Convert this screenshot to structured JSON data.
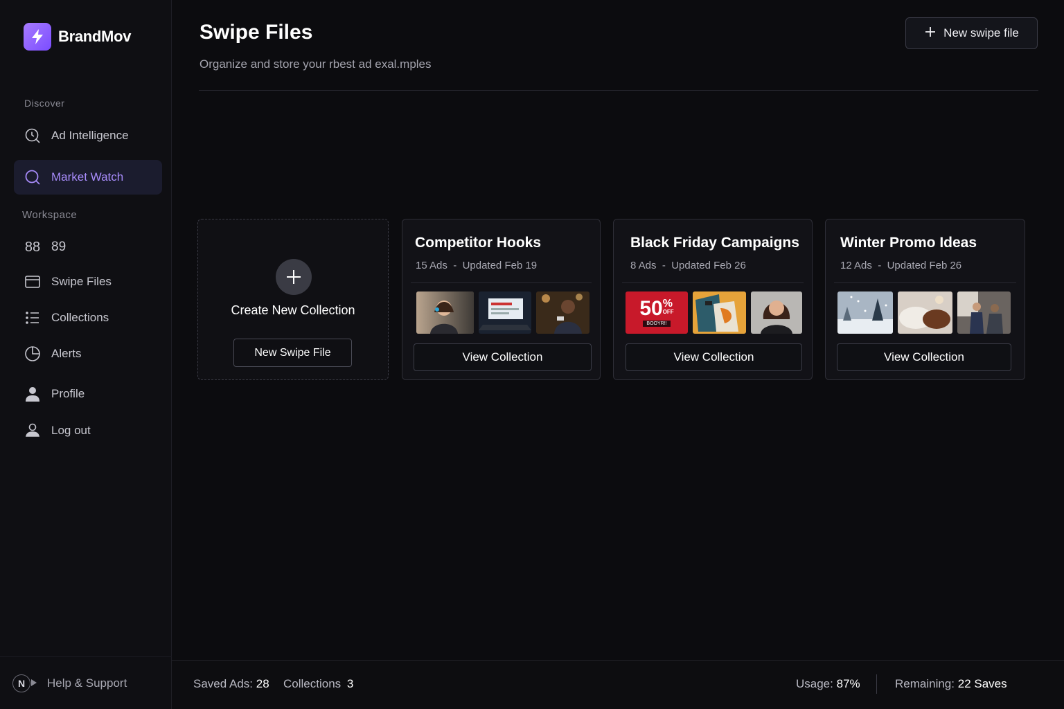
{
  "brand": {
    "name": "BrandMov",
    "logo_icon": "lightning-bolt-icon",
    "accent": "#8b5cf6"
  },
  "sidebar": {
    "discover_label": "Discover",
    "workspace_label": "Workspace",
    "items": [
      {
        "label": "Ad Intelligence",
        "icon": "clock-search-icon",
        "active": false
      },
      {
        "label": "Market Watch",
        "icon": "search-icon",
        "active": true
      },
      {
        "label": "89",
        "icon": "eighty-nine-icon",
        "icon_text": "88",
        "active": false
      },
      {
        "label": "Swipe Files",
        "icon": "folder-icon",
        "active": false
      },
      {
        "label": "Collections",
        "icon": "list-icon",
        "active": false
      },
      {
        "label": "Alerts",
        "icon": "pie-clock-icon",
        "active": false
      },
      {
        "label": "Profile",
        "icon": "user-icon",
        "active": false
      },
      {
        "label": "Log out",
        "icon": "logout-icon",
        "active": false
      }
    ],
    "help": {
      "badge": "N",
      "label": "Help & Support"
    }
  },
  "header": {
    "title": "Swipe Files",
    "subtitle": "Organize and store your rbest ad exal.mples",
    "new_button": "New swipe file"
  },
  "create_card": {
    "label": "Create New Collection",
    "button": "New Swipe File"
  },
  "collections": [
    {
      "title": "Competitor Hooks",
      "ads": "15 Ads",
      "updated": "Updated Feb 19",
      "view": "View Collection",
      "thumbnails": [
        "woman-headset-photo",
        "laptop-screen-photo",
        "man-phone-photo"
      ]
    },
    {
      "title": "Black Friday Campaigns",
      "ads": "8 Ads",
      "updated": "Updated Feb 26",
      "view": "View Collection",
      "thumbnails": [
        "sale-50-percent-off",
        "shopping-bags-photo",
        "woman-portrait-photo"
      ],
      "sale_text": {
        "big": "50",
        "pct": "%",
        "off": "OFF",
        "tag": "BOOYR!!"
      }
    },
    {
      "title": "Winter Promo Ideas",
      "ads": "12 Ads",
      "updated": "Updated Feb 26",
      "view": "View Collection",
      "thumbnails": [
        "snowy-forest-photo",
        "cozy-knit-photo",
        "people-sitting-photo"
      ]
    }
  ],
  "footer": {
    "saved_label": "Saved Ads:",
    "saved_value": "28",
    "collections_label": "Collections",
    "collections_value": "3",
    "usage_label": "Usage:",
    "usage_value": "87%",
    "remaining_label": "Remaining:",
    "remaining_value": "22 Saves"
  }
}
